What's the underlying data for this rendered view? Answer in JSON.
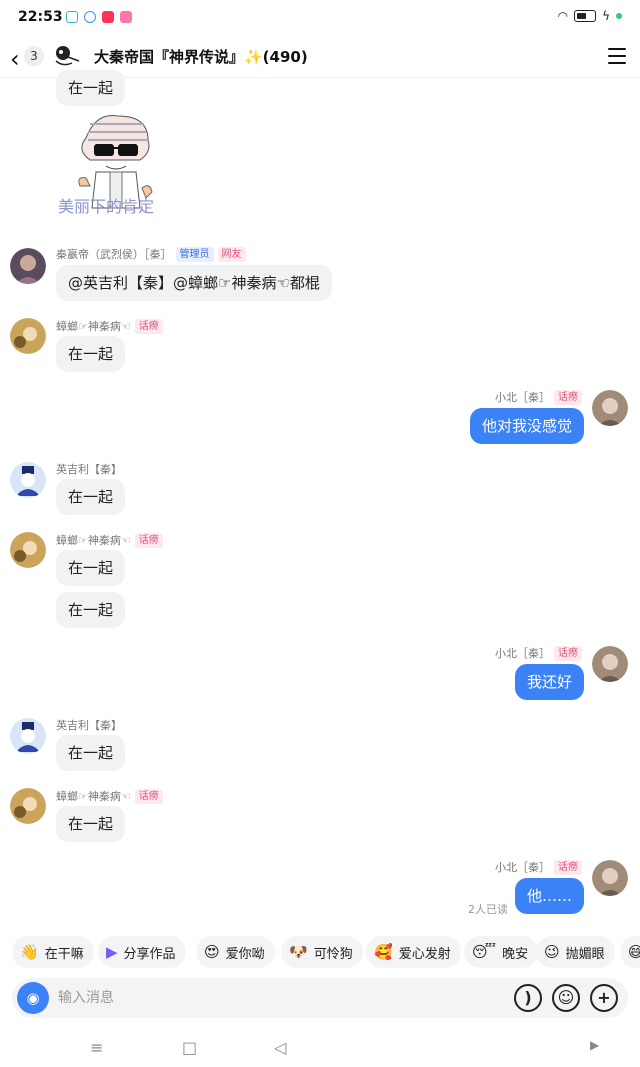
{
  "status": {
    "time": "22:53"
  },
  "header": {
    "back_count": "3",
    "title": "大秦帝国『神界传说』✨(490)"
  },
  "chat": {
    "top_bubble": "在一起",
    "sticker_caption": "美丽下的肯定",
    "m1": {
      "name": "秦嬴帝（武烈侯）［秦］",
      "tag1": "管理员",
      "tag2": "网友",
      "text": "@英吉利【秦】@蟑螂☞神秦病☜都棍"
    },
    "m2": {
      "name": "蟑螂☞神秦病☜",
      "tag": "话痨",
      "text": "在一起"
    },
    "m3": {
      "name": "小北［秦］",
      "tag": "话痨",
      "text": "他对我没感觉"
    },
    "m4": {
      "name": "英吉利【秦】",
      "text": "在一起"
    },
    "m5": {
      "name": "蟑螂☞神秦病☜",
      "tag": "话痨",
      "text1": "在一起",
      "text2": "在一起"
    },
    "m6": {
      "name": "小北［秦］",
      "tag": "话痨",
      "text": "我还好"
    },
    "m7": {
      "name": "英吉利【秦】",
      "text": "在一起"
    },
    "m8": {
      "name": "蟑螂☞神秦病☜",
      "tag": "话痨",
      "text": "在一起"
    },
    "m9": {
      "name": "小北［秦］",
      "tag": "话痨",
      "text": "他……",
      "read": "2人已读"
    }
  },
  "quick": [
    {
      "icon": "👋",
      "label": "在干嘛"
    },
    {
      "icon": "▶",
      "label": "分享作品"
    },
    {
      "icon": "😍",
      "label": "爱你呦"
    },
    {
      "icon": "🐶",
      "label": "可怜狗"
    },
    {
      "icon": "🥰",
      "label": "爱心发射"
    },
    {
      "icon": "😴",
      "label": "晚安"
    },
    {
      "icon": "😉",
      "label": "抛媚眼"
    }
  ],
  "input": {
    "placeholder": "输入消息"
  },
  "colors": {
    "accent": "#3b82f6",
    "bubble_other": "#f1f2f4",
    "tag_pink": "#e0557a"
  }
}
